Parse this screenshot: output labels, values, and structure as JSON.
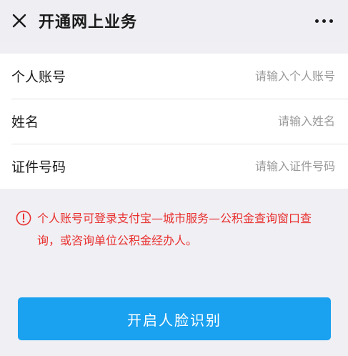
{
  "nav": {
    "title": "开通网上业务",
    "close_icon": "close-icon",
    "more_icon": "more-dots-icon"
  },
  "form": {
    "fields": [
      {
        "label": "个人账号",
        "placeholder": "请输入个人账号",
        "value": ""
      },
      {
        "label": "姓名",
        "placeholder": "请输入姓名",
        "value": ""
      },
      {
        "label": "证件号码",
        "placeholder": "请输入证件号码",
        "value": ""
      }
    ]
  },
  "notice": {
    "icon": "warning-circle-icon",
    "text": "个人账号可登录支付宝—城市服务—公积金查询窗口查询，或咨询单位公积金经办人。",
    "color": "#e8312f"
  },
  "primary_button": {
    "label": "开启人脸识别",
    "color": "#1aa1f0"
  }
}
